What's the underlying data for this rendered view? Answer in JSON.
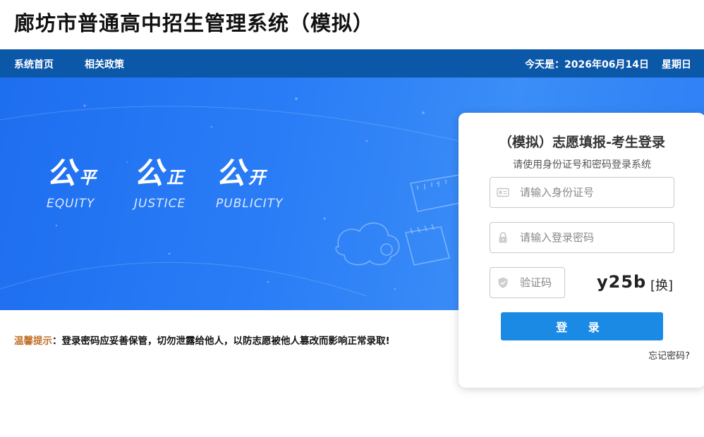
{
  "header": {
    "title": "廊坊市普通高中招生管理系统（模拟）"
  },
  "nav": {
    "items": [
      {
        "label": "系统首页"
      },
      {
        "label": "相关政策"
      }
    ],
    "date_label": "今天是：2026年06月14日",
    "weekday": "星期日"
  },
  "banner": {
    "mottos": [
      {
        "big": "公",
        "small": "平",
        "en": "EQUITY"
      },
      {
        "big": "公",
        "small": "正",
        "en": "JUSTICE"
      },
      {
        "big": "公",
        "small": "开",
        "en": "PUBLICITY"
      }
    ]
  },
  "login": {
    "title": "（模拟）志愿填报-考生登录",
    "subtitle": "请使用身份证号和密码登录系统",
    "id_placeholder": "请输入身份证号",
    "password_placeholder": "请输入登录密码",
    "captcha_placeholder": "验证码",
    "captcha_code": "y25b",
    "captcha_refresh": "[换]",
    "submit_label": "登 录",
    "forgot_label": "忘记密码?"
  },
  "notice": {
    "label": "温馨提示",
    "text": "：登录密码应妥善保管，切勿泄露给他人，以防志愿被他人篡改而影响正常录取!"
  },
  "colors": {
    "nav_bg": "#0b57a8",
    "banner_blue": "#2a7df6",
    "button_blue": "#1a8ae5",
    "notice_orange": "#c0702a"
  },
  "icons": {
    "id_field": "id-card-icon",
    "password_field": "lock-icon",
    "captcha_field": "shield-icon"
  }
}
